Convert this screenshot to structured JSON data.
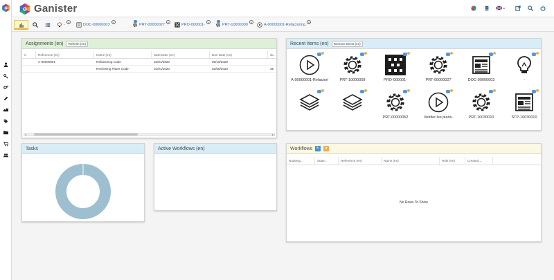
{
  "app": {
    "brand": "Ganister"
  },
  "tabs": [
    {
      "label": "-",
      "icon": "lightbulb-icon"
    },
    {
      "label": "DOC-00000003",
      "icon": "document-icon"
    },
    {
      "label": "PRT-00000027",
      "icon": "gear-icon",
      "badge": ""
    },
    {
      "label": "PRO-000001-",
      "icon": "grid-icon"
    },
    {
      "label": "PRT-10000009",
      "icon": "gear-icon",
      "badge": ""
    },
    {
      "label": "A-00000001-Refactoring",
      "icon": "play-icon"
    }
  ],
  "assignments": {
    "title": "Assignments (en)",
    "refresh_label": "Refresh (en)",
    "columns": [
      "n.",
      "Reference (en)",
      "Name (en)",
      "Start Date (en)",
      "Due Date (en)",
      "du"
    ],
    "rows": [
      [
        "",
        "A-00000001",
        "Refactoring Code",
        "02/01/2020",
        "05/10/2020",
        ""
      ],
      [
        "",
        "",
        "Reviewing Paver Code",
        "01/01/2020",
        "02/08/2020",
        "39"
      ]
    ]
  },
  "recent": {
    "title": "Recent Items (en)",
    "remove_label": "Remove Items (en)",
    "items": [
      {
        "label": "A-00000001-Refactori",
        "icon": "play-icon"
      },
      {
        "label": "PRT-10000009",
        "icon": "gear-icon"
      },
      {
        "label": "PRO-000001-",
        "icon": "grid-icon"
      },
      {
        "label": "PRT-00000027",
        "icon": "gear-icon"
      },
      {
        "label": "DOC-00000003",
        "icon": "newspaper-icon"
      },
      {
        "label": "-",
        "icon": "lightbulb-icon"
      },
      {
        "label": "",
        "icon": "layers-icon"
      },
      {
        "label": "",
        "icon": "layers-icon"
      },
      {
        "label": "PRT-00000052",
        "icon": "gear-icon"
      },
      {
        "label": "Verifier les plans-",
        "icon": "play-icon"
      },
      {
        "label": "PRT-10030010",
        "icon": "gear-icon"
      },
      {
        "label": "STP-10030010",
        "icon": "newspaper-icon"
      }
    ]
  },
  "tasks": {
    "title": "Tasks"
  },
  "active_workflows": {
    "title": "Active Workflows (en)"
  },
  "workflows": {
    "title": "Workflows",
    "columns": [
      "Nodetyp...",
      "State...",
      "Reference (en)",
      "Name (en)",
      "Role (en)",
      "Created ..."
    ],
    "empty": "No Rows To Show"
  },
  "chart_data": {
    "type": "pie",
    "categories": [
      ""
    ],
    "values": [
      100
    ],
    "title": "",
    "hole": true,
    "colors": [
      "#9ebfcf"
    ]
  }
}
